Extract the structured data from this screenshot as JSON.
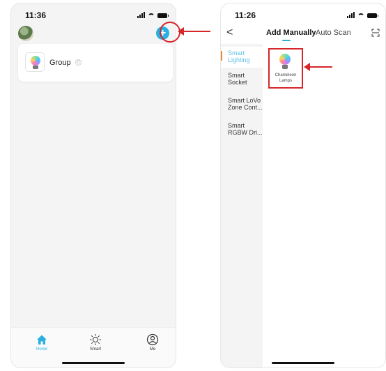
{
  "left": {
    "time": "11:36",
    "add_button": "+",
    "group": {
      "label": "Group",
      "count": "0"
    },
    "tabs": [
      {
        "label": "Home",
        "icon": "home-icon",
        "active": true
      },
      {
        "label": "Smart",
        "icon": "sun-icon",
        "active": false
      },
      {
        "label": "Me",
        "icon": "person-icon",
        "active": false
      }
    ]
  },
  "right": {
    "time": "11:26",
    "back": "<",
    "tabs": {
      "manual": "Add Manually",
      "auto": "Auto Scan"
    },
    "categories": [
      {
        "label": "Smart Lighting",
        "active": true
      },
      {
        "label": "Smart Socket",
        "active": false
      },
      {
        "label": "Smart LoVo Zone Cont...",
        "active": false
      },
      {
        "label": "Smart RGBW Dri...",
        "active": false
      }
    ],
    "device": {
      "label": "Chameleon Lamps"
    }
  },
  "colors": {
    "accent": "#2ab0e0",
    "highlight": "#d6262b",
    "active_indicator": "#f08a24"
  }
}
